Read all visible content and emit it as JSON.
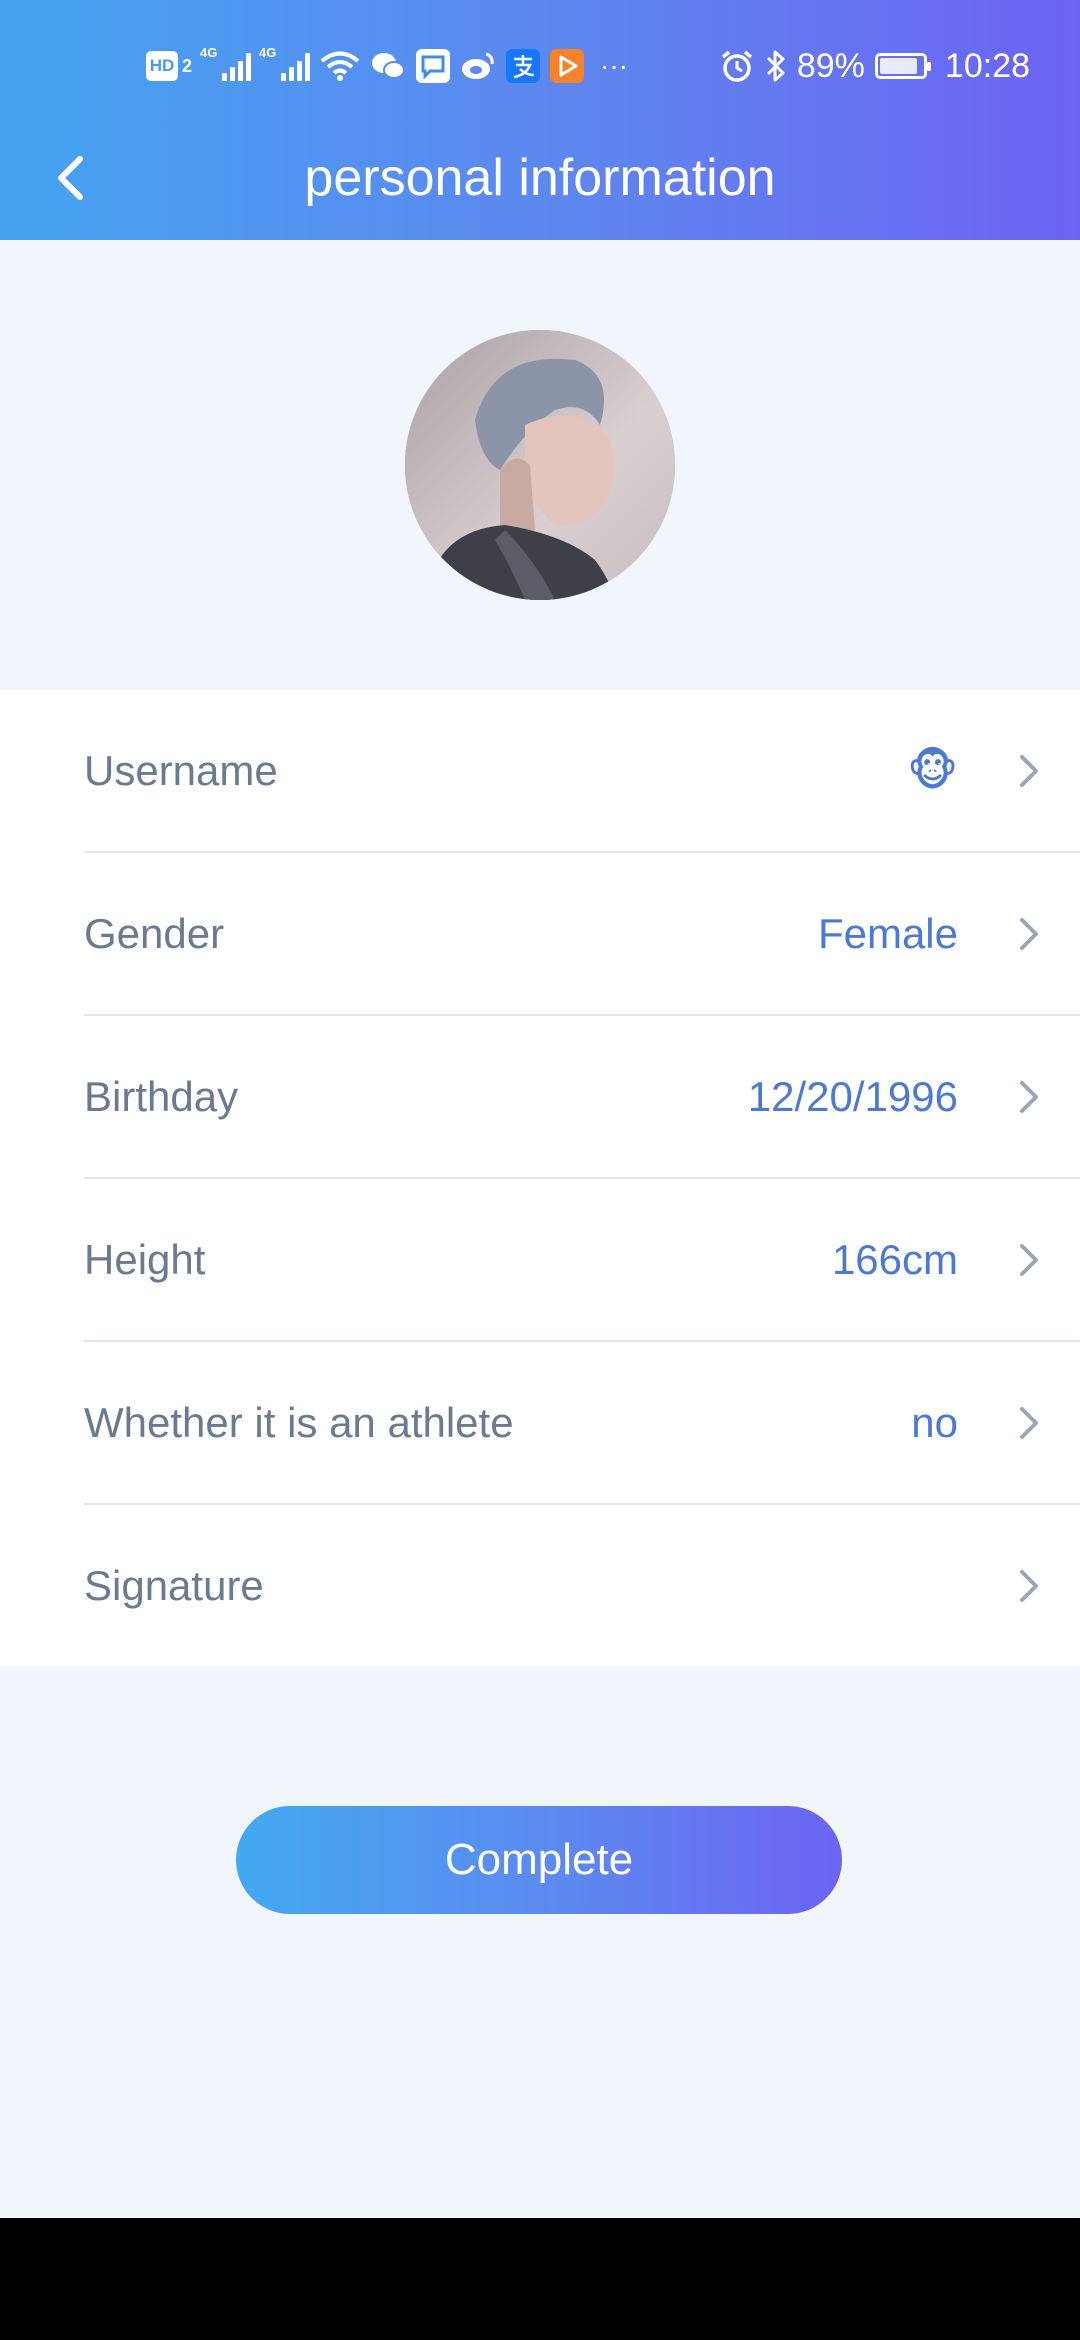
{
  "status_bar": {
    "hd_label": "HD",
    "hd_sub": "2",
    "network_1": "4G",
    "network_2": "4G",
    "more": "···",
    "battery_percent": "89%",
    "battery_level": 0.89,
    "time": "10:28"
  },
  "header": {
    "title": "personal information"
  },
  "profile_rows": [
    {
      "label": "Username",
      "value": "🐵"
    },
    {
      "label": "Gender",
      "value": "Female"
    },
    {
      "label": "Birthday",
      "value": "12/20/1996"
    },
    {
      "label": "Height",
      "value": "166cm"
    },
    {
      "label": "Whether it is an athlete",
      "value": "no"
    },
    {
      "label": "Signature",
      "value": ""
    }
  ],
  "complete_button": {
    "label": "Complete"
  },
  "colors": {
    "gradient_start": "#44a3f0",
    "gradient_end": "#6c63f3",
    "value_text": "#4d79d6",
    "label_text": "#6a7a90",
    "background": "#f1f5fc"
  }
}
